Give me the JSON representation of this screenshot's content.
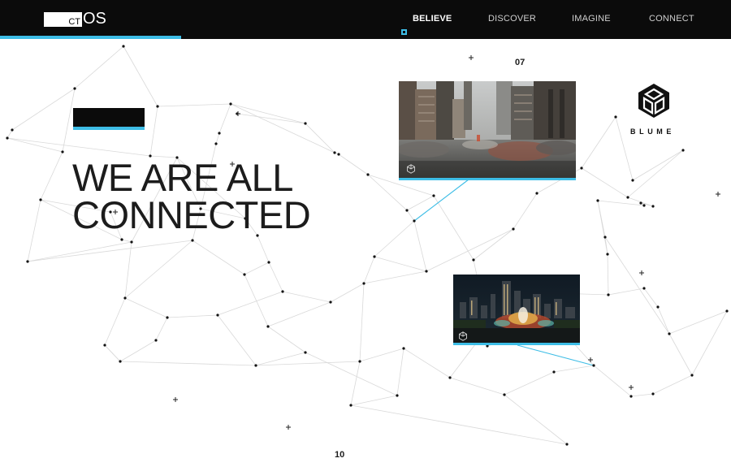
{
  "header": {
    "logo": {
      "box_text": "CT",
      "text": "OS"
    },
    "nav": [
      {
        "label": "BELIEVE",
        "active": true
      },
      {
        "label": "DISCOVER",
        "active": false
      },
      {
        "label": "IMAGINE",
        "active": false
      },
      {
        "label": "CONNECT",
        "active": false
      }
    ]
  },
  "slides": {
    "top_number": "07",
    "bottom_number": "10"
  },
  "hero": {
    "line1": "WE ARE ALL",
    "line2": "CONNECTED"
  },
  "cards": [
    {
      "subject": "blurred city street with traffic and tall buildings"
    },
    {
      "subject": "city skyline at night with illuminated fountain"
    }
  ],
  "brand": {
    "name": "BLUME",
    "icon": "hexagon-cube-icon"
  },
  "colors": {
    "accent": "#3dbde6",
    "topbar": "#0b0b0b",
    "text": "#1c1c1c",
    "network_line": "#d9d9d9",
    "network_node": "#111111"
  }
}
